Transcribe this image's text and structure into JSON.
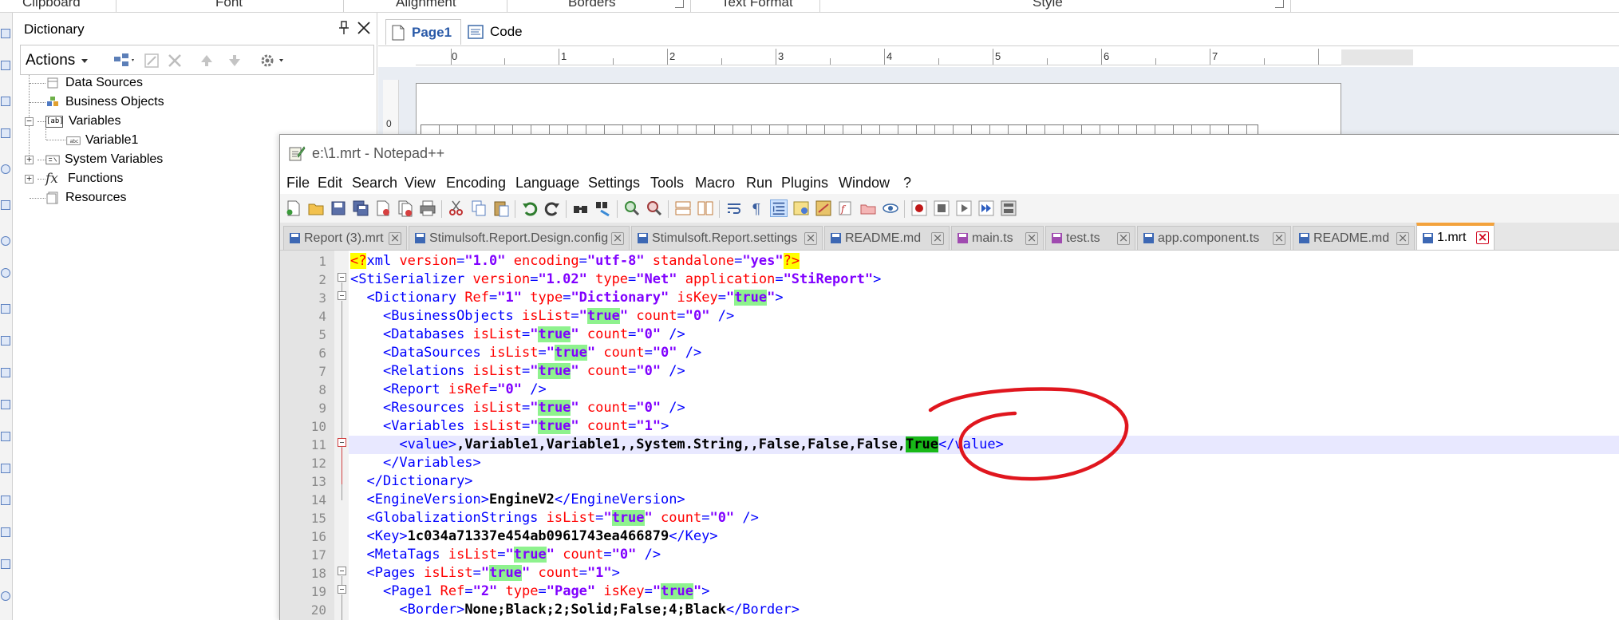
{
  "ribbon": {
    "groups": [
      "Clipboard",
      "Font",
      "Alignment",
      "Borders",
      "Text Format",
      "Style"
    ]
  },
  "dictionary": {
    "title": "Dictionary",
    "actions_label": "Actions",
    "tree": [
      {
        "label": "Data Sources",
        "icon": "data-sources-icon"
      },
      {
        "label": "Business Objects",
        "icon": "business-objects-icon"
      },
      {
        "label": "Variables",
        "icon": "variables-icon"
      },
      {
        "label": "Variable1",
        "icon": "variable-icon"
      },
      {
        "label": "System Variables",
        "icon": "system-variables-icon"
      },
      {
        "label": "Functions",
        "icon": "functions-icon"
      },
      {
        "label": "Resources",
        "icon": "resources-icon"
      }
    ],
    "functions_glyph": "fx",
    "variables_glyph": "[ab]"
  },
  "designer": {
    "tabs": [
      "Page1",
      "Code"
    ],
    "ruler": [
      "0",
      "1",
      "2",
      "3",
      "4",
      "5",
      "6",
      "7"
    ],
    "vruler": "0"
  },
  "notepad": {
    "title": "e:\\1.mrt - Notepad++",
    "menu": [
      "File",
      "Edit",
      "Search",
      "View",
      "Encoding",
      "Language",
      "Settings",
      "Tools",
      "Macro",
      "Run",
      "Plugins",
      "Window",
      "?"
    ],
    "tabs": [
      {
        "label": "Report (3).mrt"
      },
      {
        "label": "Stimulsoft.Report.Design.config"
      },
      {
        "label": "Stimulsoft.Report.settings"
      },
      {
        "label": "README.md"
      },
      {
        "label": "main.ts"
      },
      {
        "label": "test.ts"
      },
      {
        "label": "app.component.ts"
      },
      {
        "label": "README.md"
      },
      {
        "label": "1.mrt",
        "active": true
      }
    ],
    "line_numbers": [
      "1",
      "2",
      "3",
      "4",
      "5",
      "6",
      "7",
      "8",
      "9",
      "10",
      "11",
      "12",
      "13",
      "14",
      "15",
      "16",
      "17",
      "18",
      "19",
      "20"
    ],
    "code": [
      [
        [
          "pi",
          "<?"
        ],
        [
          "tg",
          "xml "
        ],
        [
          "at",
          "version"
        ],
        [
          "tg",
          "="
        ],
        [
          "vl",
          "\"1.0\""
        ],
        [
          "at",
          " encoding"
        ],
        [
          "tg",
          "="
        ],
        [
          "vl",
          "\"utf-8\""
        ],
        [
          "at",
          " standalone"
        ],
        [
          "tg",
          "="
        ],
        [
          "vl",
          "\"yes\""
        ],
        [
          "pi",
          "?>"
        ]
      ],
      [
        [
          "tg",
          "<StiSerializer "
        ],
        [
          "at",
          "version"
        ],
        [
          "tg",
          "="
        ],
        [
          "vl",
          "\"1.02\""
        ],
        [
          "at",
          " type"
        ],
        [
          "tg",
          "="
        ],
        [
          "vl",
          "\"Net\""
        ],
        [
          "at",
          " application"
        ],
        [
          "tg",
          "="
        ],
        [
          "vl",
          "\"StiReport\""
        ],
        [
          "tg",
          ">"
        ]
      ],
      [
        [
          "sp",
          "  "
        ],
        [
          "tg",
          "<Dictionary "
        ],
        [
          "at",
          "Ref"
        ],
        [
          "tg",
          "="
        ],
        [
          "vl",
          "\"1\""
        ],
        [
          "at",
          " type"
        ],
        [
          "tg",
          "="
        ],
        [
          "vl",
          "\"Dictionary\""
        ],
        [
          "at",
          " isKey"
        ],
        [
          "tg",
          "="
        ],
        [
          "vl",
          "\""
        ],
        [
          "vlh",
          "true"
        ],
        [
          "vl",
          "\""
        ],
        [
          "tg",
          ">"
        ]
      ],
      [
        [
          "sp",
          "    "
        ],
        [
          "tg",
          "<BusinessObjects "
        ],
        [
          "at",
          "isList"
        ],
        [
          "tg",
          "="
        ],
        [
          "vl",
          "\""
        ],
        [
          "vlh",
          "true"
        ],
        [
          "vl",
          "\""
        ],
        [
          "at",
          " count"
        ],
        [
          "tg",
          "="
        ],
        [
          "vl",
          "\"0\""
        ],
        [
          "tg",
          " />"
        ]
      ],
      [
        [
          "sp",
          "    "
        ],
        [
          "tg",
          "<Databases "
        ],
        [
          "at",
          "isList"
        ],
        [
          "tg",
          "="
        ],
        [
          "vl",
          "\""
        ],
        [
          "vlh",
          "true"
        ],
        [
          "vl",
          "\""
        ],
        [
          "at",
          " count"
        ],
        [
          "tg",
          "="
        ],
        [
          "vl",
          "\"0\""
        ],
        [
          "tg",
          " />"
        ]
      ],
      [
        [
          "sp",
          "    "
        ],
        [
          "tg",
          "<DataSources "
        ],
        [
          "at",
          "isList"
        ],
        [
          "tg",
          "="
        ],
        [
          "vl",
          "\""
        ],
        [
          "vlh",
          "true"
        ],
        [
          "vl",
          "\""
        ],
        [
          "at",
          " count"
        ],
        [
          "tg",
          "="
        ],
        [
          "vl",
          "\"0\""
        ],
        [
          "tg",
          " />"
        ]
      ],
      [
        [
          "sp",
          "    "
        ],
        [
          "tg",
          "<Relations "
        ],
        [
          "at",
          "isList"
        ],
        [
          "tg",
          "="
        ],
        [
          "vl",
          "\""
        ],
        [
          "vlh",
          "true"
        ],
        [
          "vl",
          "\""
        ],
        [
          "at",
          " count"
        ],
        [
          "tg",
          "="
        ],
        [
          "vl",
          "\"0\""
        ],
        [
          "tg",
          " />"
        ]
      ],
      [
        [
          "sp",
          "    "
        ],
        [
          "tg",
          "<Report "
        ],
        [
          "at",
          "isRef"
        ],
        [
          "tg",
          "="
        ],
        [
          "vl",
          "\"0\""
        ],
        [
          "tg",
          " />"
        ]
      ],
      [
        [
          "sp",
          "    "
        ],
        [
          "tg",
          "<Resources "
        ],
        [
          "at",
          "isList"
        ],
        [
          "tg",
          "="
        ],
        [
          "vl",
          "\""
        ],
        [
          "vlh",
          "true"
        ],
        [
          "vl",
          "\""
        ],
        [
          "at",
          " count"
        ],
        [
          "tg",
          "="
        ],
        [
          "vl",
          "\"0\""
        ],
        [
          "tg",
          " />"
        ]
      ],
      [
        [
          "sp",
          "    "
        ],
        [
          "tg",
          "<Variables "
        ],
        [
          "at",
          "isList"
        ],
        [
          "tg",
          "="
        ],
        [
          "vl",
          "\""
        ],
        [
          "vlh",
          "true"
        ],
        [
          "vl",
          "\""
        ],
        [
          "at",
          " count"
        ],
        [
          "tg",
          "="
        ],
        [
          "vl",
          "\"1\""
        ],
        [
          "tg",
          ">"
        ]
      ],
      [
        [
          "sp",
          "      "
        ],
        [
          "tg",
          "<value>"
        ],
        [
          "tx",
          ",Variable1,Variable1,,System.String,,False,False,False,"
        ],
        [
          "txh",
          "True"
        ],
        [
          "tg",
          "</value>"
        ]
      ],
      [
        [
          "sp",
          "    "
        ],
        [
          "tg",
          "</Variables>"
        ]
      ],
      [
        [
          "sp",
          "  "
        ],
        [
          "tg",
          "</Dictionary>"
        ]
      ],
      [
        [
          "sp",
          "  "
        ],
        [
          "tg",
          "<EngineVersion>"
        ],
        [
          "tx",
          "EngineV2"
        ],
        [
          "tg",
          "</EngineVersion>"
        ]
      ],
      [
        [
          "sp",
          "  "
        ],
        [
          "tg",
          "<GlobalizationStrings "
        ],
        [
          "at",
          "isList"
        ],
        [
          "tg",
          "="
        ],
        [
          "vl",
          "\""
        ],
        [
          "vlh",
          "true"
        ],
        [
          "vl",
          "\""
        ],
        [
          "at",
          " count"
        ],
        [
          "tg",
          "="
        ],
        [
          "vl",
          "\"0\""
        ],
        [
          "tg",
          " />"
        ]
      ],
      [
        [
          "sp",
          "  "
        ],
        [
          "tg",
          "<Key>"
        ],
        [
          "tx",
          "1c034a71337e454ab0961743ea466879"
        ],
        [
          "tg",
          "</Key>"
        ]
      ],
      [
        [
          "sp",
          "  "
        ],
        [
          "tg",
          "<MetaTags "
        ],
        [
          "at",
          "isList"
        ],
        [
          "tg",
          "="
        ],
        [
          "vl",
          "\""
        ],
        [
          "vlh",
          "true"
        ],
        [
          "vl",
          "\""
        ],
        [
          "at",
          " count"
        ],
        [
          "tg",
          "="
        ],
        [
          "vl",
          "\"0\""
        ],
        [
          "tg",
          " />"
        ]
      ],
      [
        [
          "sp",
          "  "
        ],
        [
          "tg",
          "<Pages "
        ],
        [
          "at",
          "isList"
        ],
        [
          "tg",
          "="
        ],
        [
          "vl",
          "\""
        ],
        [
          "vlh",
          "true"
        ],
        [
          "vl",
          "\""
        ],
        [
          "at",
          " count"
        ],
        [
          "tg",
          "="
        ],
        [
          "vl",
          "\"1\""
        ],
        [
          "tg",
          ">"
        ]
      ],
      [
        [
          "sp",
          "    "
        ],
        [
          "tg",
          "<Page1 "
        ],
        [
          "at",
          "Ref"
        ],
        [
          "tg",
          "="
        ],
        [
          "vl",
          "\"2\""
        ],
        [
          "at",
          " type"
        ],
        [
          "tg",
          "="
        ],
        [
          "vl",
          "\"Page\""
        ],
        [
          "at",
          " isKey"
        ],
        [
          "tg",
          "="
        ],
        [
          "vl",
          "\""
        ],
        [
          "vlh",
          "true"
        ],
        [
          "vl",
          "\""
        ],
        [
          "tg",
          ">"
        ]
      ],
      [
        [
          "sp",
          "      "
        ],
        [
          "tg",
          "<Border>"
        ],
        [
          "tx",
          "None;Black;2;Solid;False;4;Black"
        ],
        [
          "tg",
          "</Border>"
        ]
      ]
    ],
    "current_line": 11
  },
  "colors": {
    "accent_tab": "#f3a23c",
    "highlight": "#8ef28e",
    "annotation": "#e0161e"
  }
}
